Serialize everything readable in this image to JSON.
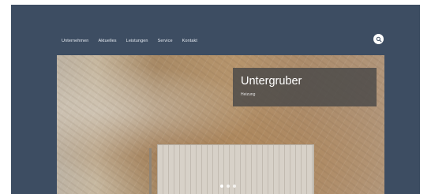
{
  "nav": {
    "items": [
      {
        "label": "Unternehmen"
      },
      {
        "label": "Aktuelles"
      },
      {
        "label": "Leistungen"
      },
      {
        "label": "Service"
      },
      {
        "label": "Kontakt"
      }
    ]
  },
  "search": {
    "icon": "search-icon"
  },
  "hero": {
    "title": "Untergruber",
    "subtitle": "Heizung",
    "slides": 3,
    "active_slide": 1
  },
  "colors": {
    "header_bg": "#3d4d62",
    "caption_bg": "#484848",
    "nav_text": "#e6ebf2"
  }
}
